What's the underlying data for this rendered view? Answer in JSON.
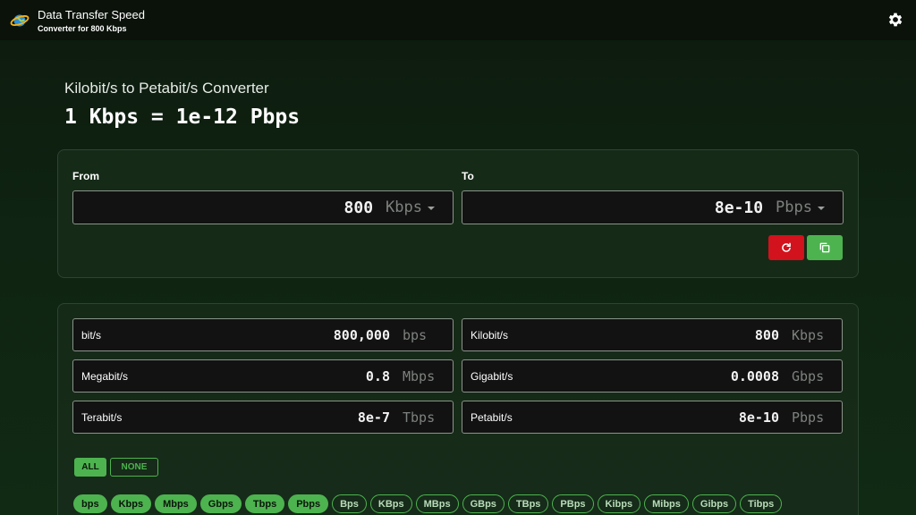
{
  "header": {
    "title": "Data Transfer Speed",
    "subtitle": "Converter for 800 Kbps"
  },
  "main": {
    "heading": "Kilobit/s to Petabit/s Converter",
    "formula": "1 Kbps = 1e-12 Pbps"
  },
  "converter": {
    "from_label": "From",
    "from_value": "800",
    "from_unit": "Kbps",
    "to_label": "To",
    "to_value": "8e-10",
    "to_unit": "Pbps"
  },
  "results": [
    {
      "name": "bit/s",
      "value": "800,000",
      "unit": "bps"
    },
    {
      "name": "Kilobit/s",
      "value": "800",
      "unit": "Kbps"
    },
    {
      "name": "Megabit/s",
      "value": "0.8",
      "unit": "Mbps"
    },
    {
      "name": "Gigabit/s",
      "value": "0.0008",
      "unit": "Gbps"
    },
    {
      "name": "Terabit/s",
      "value": "8e-7",
      "unit": "Tbps"
    },
    {
      "name": "Petabit/s",
      "value": "8e-10",
      "unit": "Pbps"
    }
  ],
  "selection": {
    "all_label": "ALL",
    "none_label": "NONE"
  },
  "chips": [
    {
      "label": "bps",
      "selected": true
    },
    {
      "label": "Kbps",
      "selected": true
    },
    {
      "label": "Mbps",
      "selected": true
    },
    {
      "label": "Gbps",
      "selected": true
    },
    {
      "label": "Tbps",
      "selected": true
    },
    {
      "label": "Pbps",
      "selected": true
    },
    {
      "label": "Bps",
      "selected": false
    },
    {
      "label": "KBps",
      "selected": false
    },
    {
      "label": "MBps",
      "selected": false
    },
    {
      "label": "GBps",
      "selected": false
    },
    {
      "label": "TBps",
      "selected": false
    },
    {
      "label": "PBps",
      "selected": false
    },
    {
      "label": "Kibps",
      "selected": false
    },
    {
      "label": "Mibps",
      "selected": false
    },
    {
      "label": "Gibps",
      "selected": false
    },
    {
      "label": "Tibps",
      "selected": false
    }
  ],
  "colors": {
    "accent_green": "#4db34f",
    "reset_red": "#d2121c",
    "background": "#0f2412"
  },
  "icons": {
    "logo": "globe-logo-icon",
    "settings": "gear-icon",
    "reset": "refresh-icon",
    "copy": "copy-icon",
    "dropdown": "caret-down-icon"
  }
}
